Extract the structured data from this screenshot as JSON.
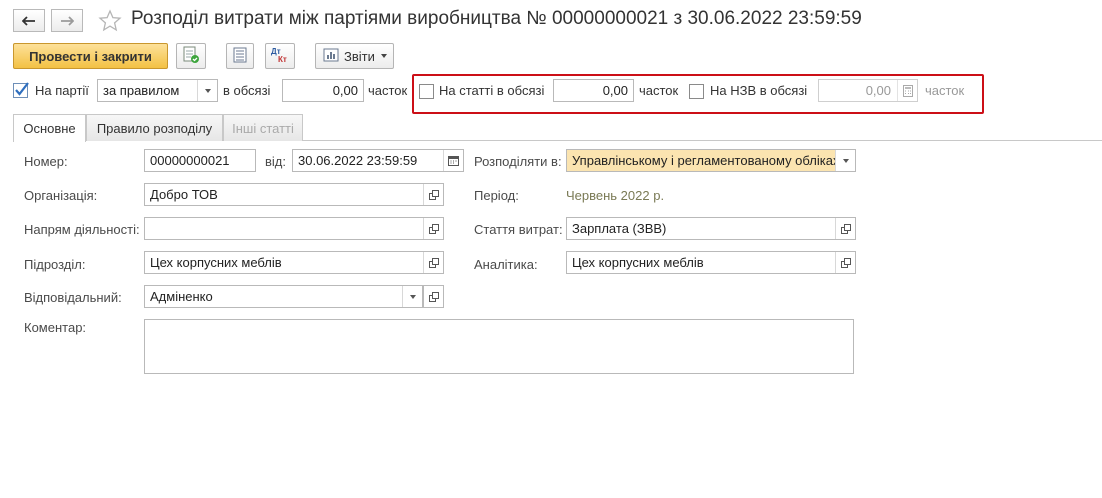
{
  "window": {
    "title": "Розподіл витрати між партіями виробництва № 00000000021 з 30.06.2022 23:59:59"
  },
  "nav": {
    "back_icon": "arrow-left-icon",
    "forward_icon": "arrow-right-icon",
    "favorite_icon": "star-icon"
  },
  "toolbar": {
    "post_close_label": "Провести і закрити",
    "post_icon": "post-document-icon",
    "list_icon": "document-list-icon",
    "dtkt_icon": "dt-kt-icon",
    "dt_text": "Дт",
    "kt_text": "Кт",
    "reports_label": "Звіти",
    "reports_icon": "reports-icon"
  },
  "options": {
    "on_batch": {
      "label": "На партії",
      "checked": true
    },
    "batch_mode": "за правилом",
    "in_volume_label": "в обсязі",
    "batch_volume": "0,00",
    "parts_label_1": "часток",
    "on_item": {
      "label": "На статті в обсязі",
      "checked": false
    },
    "item_volume": "0,00",
    "parts_label_2": "часток",
    "on_wip": {
      "label": "На НЗВ в обсязі",
      "checked": false
    },
    "wip_volume": "0,00",
    "parts_label_3": "часток"
  },
  "tabs": [
    {
      "label": "Основне",
      "active": true
    },
    {
      "label": "Правило розподілу",
      "active": false
    },
    {
      "label": "Інші статті",
      "disabled": true
    }
  ],
  "form": {
    "number_label": "Номер:",
    "number_value": "00000000021",
    "date_label": "від:",
    "date_value": "30.06.2022 23:59:59",
    "org_label": "Організація:",
    "org_value": "Добро ТОВ",
    "direction_label": "Напрям діяльності:",
    "direction_value": "",
    "subdivision_label": "Підрозділ:",
    "subdivision_value": "Цех корпусних меблів",
    "responsible_label": "Відповідальний:",
    "responsible_value": "Адміненко",
    "comment_label": "Коментар:",
    "comment_value": "",
    "distribute_label": "Розподіляти в:",
    "distribute_value": "Управлінському і регламентованому облікаx",
    "period_label": "Період:",
    "period_value": "Червень 2022 р.",
    "cost_item_label": "Стаття витрат:",
    "cost_item_value": "Зарплата (ЗВВ)",
    "analytics_label": "Аналітика:",
    "analytics_value": "Цех корпусних меблів"
  },
  "colors": {
    "primary_button": "#f3c144",
    "highlight_frame": "#cc0f17",
    "checkbox_check": "#2f6fbf",
    "distribute_field_bg": "#fbe4b0"
  }
}
